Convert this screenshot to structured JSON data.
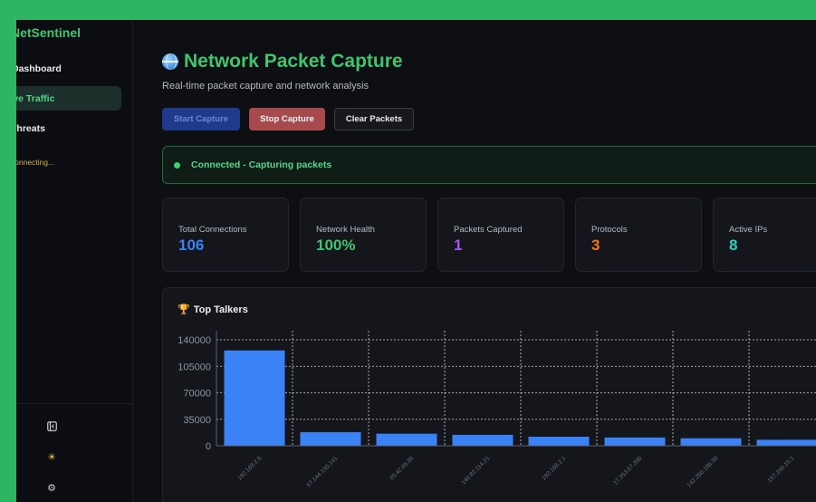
{
  "app": {
    "brand": "NetSentinel"
  },
  "sidebar": {
    "items": [
      {
        "label": "Dashboard",
        "active": false
      },
      {
        "label": "Live Traffic",
        "active": true
      },
      {
        "label": "Threats",
        "active": false
      }
    ],
    "status": "Connecting...",
    "bottom_icons": [
      "collapse-icon",
      "theme-sun-icon",
      "settings-gear-icon"
    ]
  },
  "header": {
    "title": "Network Packet Capture",
    "subtitle": "Real-time packet capture and network analysis"
  },
  "toolbar": {
    "start_label": "Start Capture",
    "stop_label": "Stop Capture",
    "clear_label": "Clear Packets"
  },
  "status": {
    "text": "Connected - Capturing packets",
    "color": "#3fd07a"
  },
  "stats": [
    {
      "label": "Total Connections",
      "value": "106",
      "color": "#3b82f6"
    },
    {
      "label": "Network Health",
      "value": "100%",
      "color": "#3fc46f"
    },
    {
      "label": "Packets Captured",
      "value": "1",
      "color": "#a855f7"
    },
    {
      "label": "Protocols",
      "value": "3",
      "color": "#f97316"
    },
    {
      "label": "Active IPs",
      "value": "8",
      "color": "#2dd4bf"
    }
  ],
  "top_talkers": {
    "title": "Top Talkers",
    "chart_data": {
      "type": "bar",
      "categories": [
        "192.168.2.5",
        "57.144.150.141",
        "20.42.65.85",
        "140.82.114.21",
        "192.168.2.1",
        "17.253.67.200",
        "142.250.188.99",
        "157.240.15.1"
      ],
      "values": [
        126000,
        18000,
        16000,
        14500,
        12000,
        11000,
        10000,
        8000
      ],
      "yticks": [
        0,
        35000,
        70000,
        105000,
        140000
      ],
      "ylim": [
        0,
        140000
      ],
      "bar_color": "#3b82f6"
    }
  }
}
